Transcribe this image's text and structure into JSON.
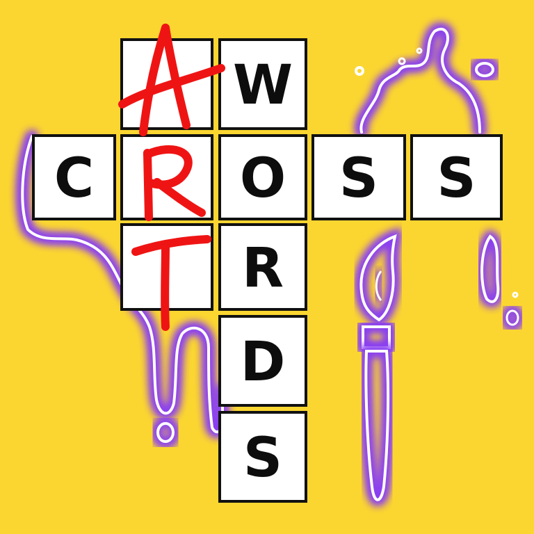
{
  "colors": {
    "background": "#fbd631",
    "neon": "#8a3ff2",
    "neon_core": "#ffffff",
    "tile_fill": "#ffffff",
    "tile_border": "#111111",
    "letter": "#0d0d0d",
    "art_red": "#ef1414"
  },
  "title": {
    "row_word": [
      "C",
      "R",
      "O",
      "S",
      "S"
    ],
    "column_word": [
      "W",
      "O",
      "R",
      "D",
      "S"
    ],
    "art_word": [
      "A",
      "R",
      "T"
    ]
  },
  "decorations": {
    "paint_splatter_icon": "paint-splatter",
    "paintbrush_icon": "paintbrush"
  }
}
